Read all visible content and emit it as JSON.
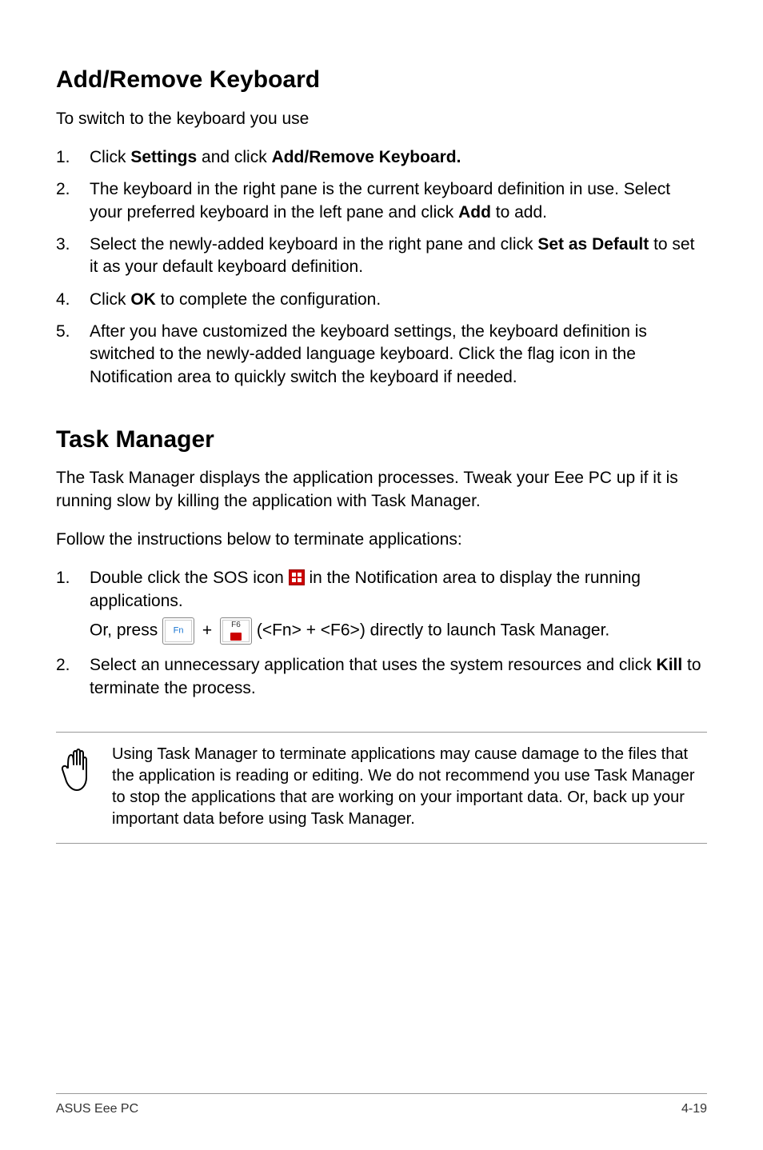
{
  "section1": {
    "heading": "Add/Remove Keyboard",
    "intro": "To switch to the keyboard you use",
    "steps": [
      {
        "num": "1.",
        "pre": "Click ",
        "b1": "Settings",
        "mid": " and click ",
        "b2": "Add/Remove Keyboard."
      },
      {
        "num": "2.",
        "pre": "The keyboard in the right pane is the current keyboard definition in use. Select your preferred keyboard in the left pane and click ",
        "b1": "Add",
        "post": " to add."
      },
      {
        "num": "3.",
        "pre": "Select the newly-added keyboard in the right pane and click ",
        "b1": "Set as Default",
        "post": " to set it as your default keyboard definition."
      },
      {
        "num": "4.",
        "pre": "Click ",
        "b1": "OK",
        "post": " to complete the configuration."
      },
      {
        "num": "5.",
        "text": "After you have customized the keyboard settings, the keyboard definition is switched to the newly-added language keyboard. Click the flag icon in the Notification area to quickly switch the keyboard if needed."
      }
    ]
  },
  "section2": {
    "heading": "Task Manager",
    "intro": "The Task Manager displays the application processes. Tweak your Eee PC up if it is running slow by killing the application with Task Manager.",
    "follow": "Follow the instructions below to terminate applications:",
    "step1": {
      "num": "1.",
      "pre": "Double click the SOS icon ",
      "post": " in the Notification area to display the running applications.",
      "or_pre": "Or, press ",
      "or_post": " (<Fn> + <F6>) directly to launch Task Manager.",
      "fn": "Fn",
      "f6": "F6",
      "plus": "+"
    },
    "step2": {
      "num": "2.",
      "pre": "Select an unnecessary application that uses the system resources and click ",
      "b1": "Kill",
      "post": " to terminate the process."
    },
    "note": "Using Task Manager to terminate applications may cause damage to the files that the application is reading or editing. We do not recommend you use Task Manager to stop the applications that are working on your important data. Or, back up your important data before using Task Manager."
  },
  "footer": {
    "left": "ASUS Eee PC",
    "right": "4-19"
  }
}
